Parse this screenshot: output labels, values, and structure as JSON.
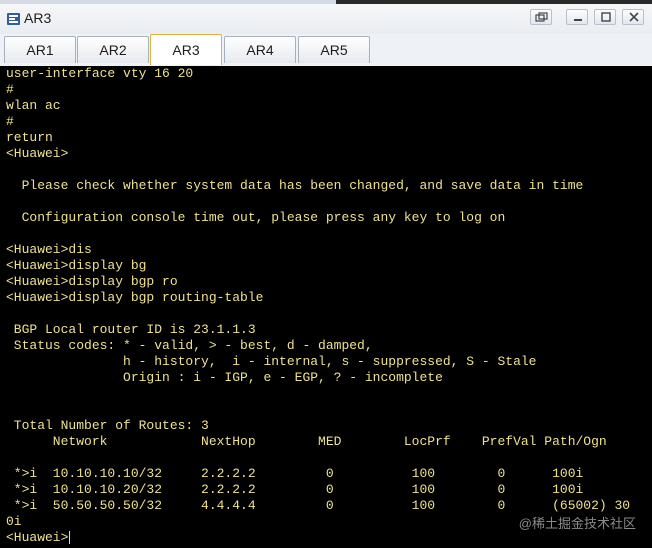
{
  "window": {
    "title": "AR3",
    "icon": "router-app-icon",
    "controls": [
      "restore-icon",
      "minimize-icon",
      "maximize-icon",
      "close-icon"
    ]
  },
  "tabs": [
    {
      "label": "AR1",
      "active": false
    },
    {
      "label": "AR2",
      "active": false
    },
    {
      "label": "AR3",
      "active": true
    },
    {
      "label": "AR4",
      "active": false
    },
    {
      "label": "AR5",
      "active": false
    }
  ],
  "terminal": {
    "text_color": "#efe18a",
    "background": "#000000",
    "lines": [
      "user-interface vty 16 20",
      "#",
      "wlan ac",
      "#",
      "return",
      "<Huawei>",
      "",
      "  Please check whether system data has been changed, and save data in time",
      "",
      "  Configuration console time out, please press any key to log on",
      "",
      "<Huawei>dis",
      "<Huawei>display bg",
      "<Huawei>display bgp ro",
      "<Huawei>display bgp routing-table",
      "",
      " BGP Local router ID is 23.1.1.3",
      " Status codes: * - valid, > - best, d - damped,",
      "               h - history,  i - internal, s - suppressed, S - Stale",
      "               Origin : i - IGP, e - EGP, ? - incomplete",
      "",
      "",
      " Total Number of Routes: 3",
      "      Network            NextHop        MED        LocPrf    PrefVal Path/Ogn",
      "",
      " *>i  10.10.10.10/32     2.2.2.2         0          100        0      100i",
      " *>i  10.10.10.20/32     2.2.2.2         0          100        0      100i",
      " *>i  50.50.50.50/32     4.4.4.4         0          100        0      (65002) 30",
      "0i",
      "<Huawei>"
    ]
  },
  "watermark": "@稀土掘金技术社区"
}
